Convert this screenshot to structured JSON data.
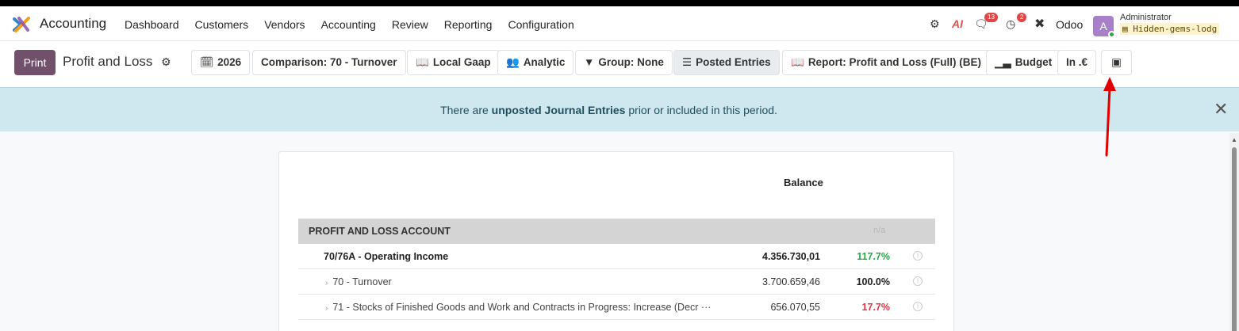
{
  "navbar": {
    "app_name": "Accounting",
    "menu": [
      "Dashboard",
      "Customers",
      "Vendors",
      "Accounting",
      "Review",
      "Reporting",
      "Configuration"
    ],
    "messages_badge": "13",
    "activities_badge": "2",
    "company": "Odoo",
    "avatar_letter": "A",
    "user_name": "Administrator",
    "database": "Hidden-gems-lodg"
  },
  "control_panel": {
    "print_label": "Print",
    "title": "Profit and Loss",
    "filters": {
      "date": "2026",
      "comparison": "Comparison: 70 - Turnover",
      "journal": "Local Gaap",
      "analytic": "Analytic",
      "group": "Group: None",
      "posted": "Posted Entries",
      "report": "Report: Profit and Loss (Full) (BE)",
      "budget": "Budget",
      "currency": "In .€"
    }
  },
  "alert": {
    "prefix": "There are ",
    "bold": "unposted Journal Entries",
    "suffix": " prior or included in this period."
  },
  "report": {
    "column_header": "Balance",
    "section_label": "PROFIT AND LOSS ACCOUNT",
    "section_na": "n/a",
    "lines": [
      {
        "name": "70/76A - Operating Income",
        "balance": "4.356.730,01",
        "pct": "117.7%"
      },
      {
        "name": "70 - Turnover",
        "balance": "3.700.659,46",
        "pct": "100.0%"
      },
      {
        "name": "71 - Stocks of Finished Goods and Work and Contracts in Progress: Increase (Decr ···",
        "balance": "656.070,55",
        "pct": "17.7%"
      }
    ]
  },
  "colors": {
    "primary": "#71506b",
    "alert_bg": "#cfe8ef",
    "positive": "#28a745",
    "negative": "#dc3545",
    "annotation": "#e00000"
  }
}
